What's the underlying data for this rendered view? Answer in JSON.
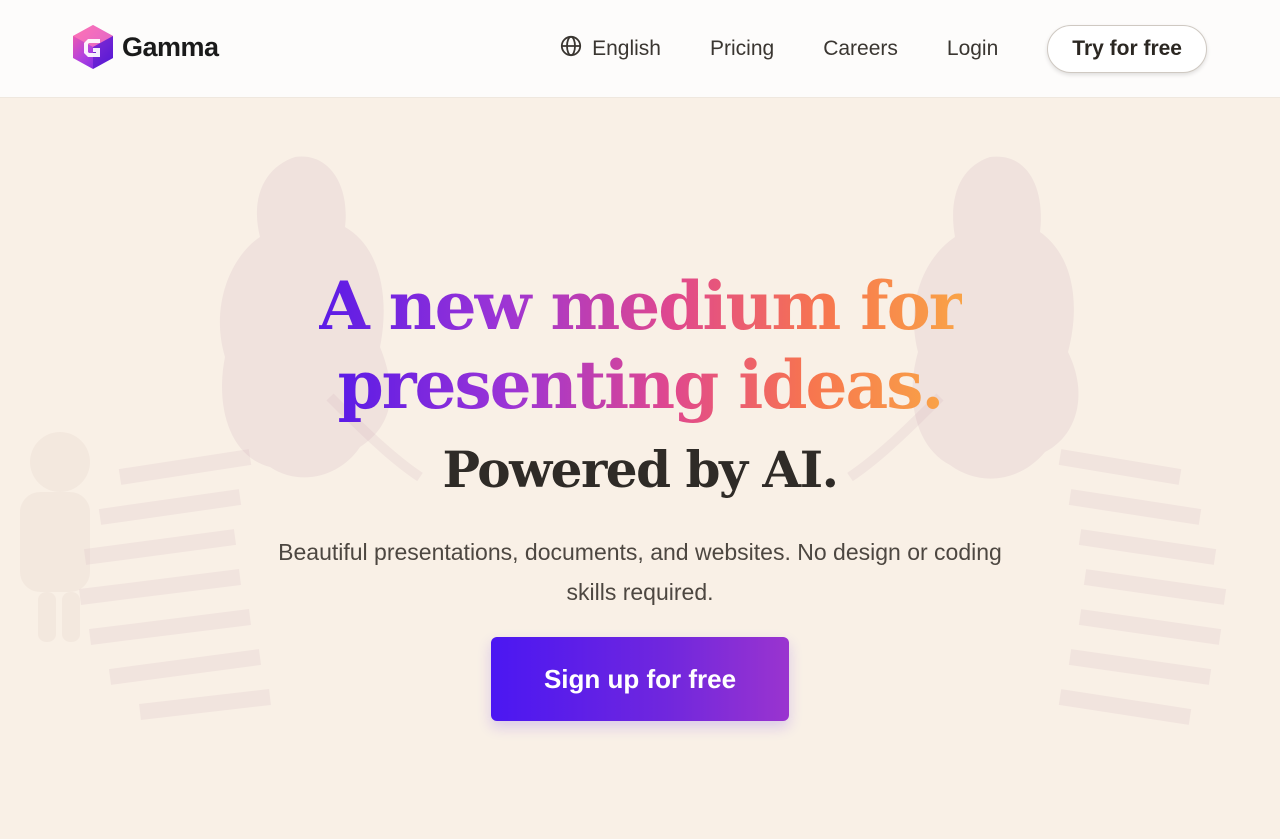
{
  "header": {
    "logo_text": "Gamma",
    "logo_icon": "gamma-logo-icon",
    "nav": {
      "language_icon": "globe-icon",
      "language_label": "English",
      "pricing_label": "Pricing",
      "careers_label": "Careers",
      "login_label": "Login",
      "cta_label": "Try for free"
    }
  },
  "hero": {
    "headline_line1_part1": "A new medium for",
    "headline_line2": "presenting ideas.",
    "subheadline": "Powered by AI.",
    "description": "Beautiful presentations, documents, and websites. No design or coding skills required.",
    "primary_cta": "Sign up for free"
  },
  "colors": {
    "background": "#f9f0e6",
    "header_background": "#fdfcfb",
    "gradient_start": "#5b1be6",
    "gradient_mid": "#e0488e",
    "gradient_end": "#f9a347",
    "button_gradient_start": "#4b17f2",
    "button_gradient_end": "#9a34cf"
  }
}
